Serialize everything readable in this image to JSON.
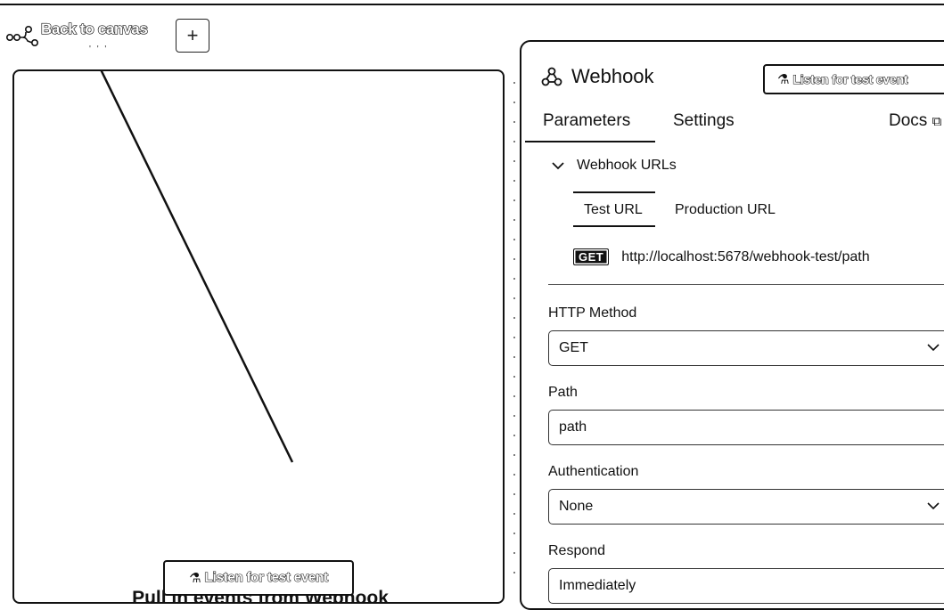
{
  "nav": {
    "back_label": "Back to canvas",
    "add_icon": "plus-icon",
    "ticks": "' ' '"
  },
  "left_panel": {
    "title": "Pull in events from Webhook",
    "listen_label": "Listen for test event",
    "listen_icon": "flask-icon"
  },
  "node": {
    "title": "Webhook",
    "icon": "webhook-icon",
    "listen_label": "Listen for test event",
    "listen_icon": "flask-icon",
    "tabs": [
      "Parameters",
      "Settings"
    ],
    "active_tab": "Parameters",
    "docs_label": "Docs",
    "docs_icon": "external-link-icon"
  },
  "webhook_urls": {
    "section_label": "Webhook URLs",
    "toggle_icon": "chevron-down-icon",
    "url_tabs": [
      "Test URL",
      "Production URL"
    ],
    "active_url_tab": "Test URL",
    "method_badge": "GET",
    "url": "http://localhost:5678/webhook-test/path"
  },
  "fields": {
    "http_method": {
      "label": "HTTP Method",
      "value": "GET"
    },
    "path": {
      "label": "Path",
      "value": "path"
    },
    "authentication": {
      "label": "Authentication",
      "value": "None"
    },
    "respond": {
      "label": "Respond",
      "value": "Immediately"
    }
  },
  "colors": {
    "ink": "#111111",
    "background": "#ffffff"
  }
}
